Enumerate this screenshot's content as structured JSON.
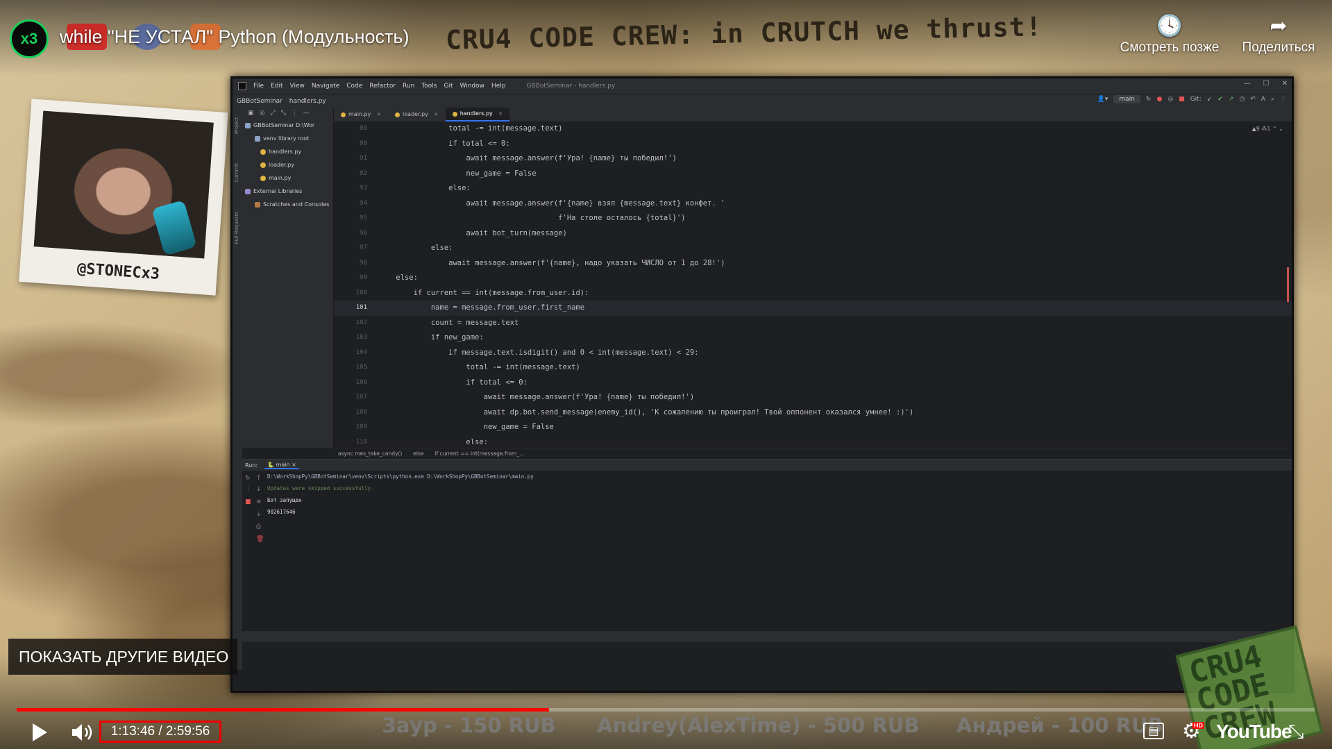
{
  "channel": {
    "logo_text": "x3"
  },
  "video": {
    "title": "while \"НЕ УСТАЛ\" Python (Модульность)",
    "banner": "CRU4 CODE CREW: in CRUTCH we thrust!",
    "actions": {
      "watch_later": "Смотреть позже",
      "share": "Поделиться"
    }
  },
  "presenter": {
    "handle": "@STONECx3"
  },
  "ide": {
    "menu": [
      "File",
      "Edit",
      "View",
      "Navigate",
      "Code",
      "Refactor",
      "Run",
      "Tools",
      "Git",
      "Window",
      "Help"
    ],
    "project_title": "GBBotSeminar - handlers.py",
    "breadcrumbs": [
      "GBBotSeminar",
      "handlers.py"
    ],
    "branch": "main",
    "git_label": "Git:",
    "project_tree": [
      {
        "label": "GBBotSeminar  D:\\Wor",
        "type": "folder"
      },
      {
        "label": "venv  library root",
        "type": "folder"
      },
      {
        "label": "handlers.py",
        "type": "py"
      },
      {
        "label": "loader.py",
        "type": "py"
      },
      {
        "label": "main.py",
        "type": "py"
      },
      {
        "label": "External Libraries",
        "type": "lib"
      },
      {
        "label": "Scratches and Consoles",
        "type": "scr"
      }
    ],
    "tabs": [
      {
        "label": "main.py",
        "active": false
      },
      {
        "label": "loader.py",
        "active": false
      },
      {
        "label": "handlers.py",
        "active": true
      }
    ],
    "analysis": "▲9 ⁂1 ⌃ ⌄",
    "code_lines": [
      {
        "n": "89",
        "text": "                total -= int(message.text)"
      },
      {
        "n": "90",
        "text": "                if total <= 0:"
      },
      {
        "n": "91",
        "text": "                    await message.answer(f'Ура! {name} ты победил!')"
      },
      {
        "n": "92",
        "text": "                    new_game = False"
      },
      {
        "n": "93",
        "text": "                else:"
      },
      {
        "n": "94",
        "text": "                    await message.answer(f'{name} взял {message.text} конфет. '"
      },
      {
        "n": "95",
        "text": "                                         f'На столе осталось {total}')"
      },
      {
        "n": "96",
        "text": "                    await bot_turn(message)"
      },
      {
        "n": "97",
        "text": "            else:"
      },
      {
        "n": "98",
        "text": "                await message.answer(f'{name}, надо указать ЧИСЛО от 1 до 28!')"
      },
      {
        "n": "99",
        "text": "    else:"
      },
      {
        "n": "100",
        "text": "        if current == int(message.from_user.id):"
      },
      {
        "n": "101",
        "text": "            name = message.from_user.first_name",
        "current": true
      },
      {
        "n": "102",
        "text": "            count = message.text"
      },
      {
        "n": "103",
        "text": "            if new_game:"
      },
      {
        "n": "104",
        "text": "                if message.text.isdigit() and 0 < int(message.text) < 29:"
      },
      {
        "n": "105",
        "text": "                    total -= int(message.text)"
      },
      {
        "n": "106",
        "text": "                    if total <= 0:"
      },
      {
        "n": "107",
        "text": "                        await message.answer(f'Ура! {name} ты победил!')"
      },
      {
        "n": "108",
        "text": "                        await dp.bot.send_message(enemy_id(), 'К сожалению ты проиграл! Твой оппонент оказался умнее! :)')"
      },
      {
        "n": "109",
        "text": "                        new_game = False"
      },
      {
        "n": "110",
        "text": "                    else:"
      }
    ],
    "code_breadcrumb": [
      "async mes_take_candy()",
      "else",
      "if current == int(message.from_..."
    ],
    "run": {
      "label": "Run:",
      "config": "main",
      "output": [
        "D:\\WorkShopPy\\GBBotSeminar\\venv\\Scripts\\python.exe D:\\WorkShopPy\\GBBotSeminar\\main.py",
        "Updates were skipped successfully.",
        "Бот запущен",
        "902617646"
      ]
    }
  },
  "overlay": {
    "more_videos": "ПОКАЗАТЬ ДРУГИЕ ВИДЕО",
    "stamp": "CRU4 CODE CREW",
    "donations": [
      "Заур - 150 RUB",
      "Andrey(AlexTime) - 500 RUB",
      "Андрей - 100 RUB"
    ]
  },
  "player": {
    "time": "1:13:46 / 2:59:56",
    "progress": 0.4101,
    "buffered": 0.4101,
    "logo": "YouTube",
    "hd_badge": "HD",
    "accent": "#ff0000",
    "icons": [
      "play-icon",
      "volume-icon",
      "subtitles-icon",
      "settings-icon",
      "fullscreen-exit-icon"
    ]
  }
}
